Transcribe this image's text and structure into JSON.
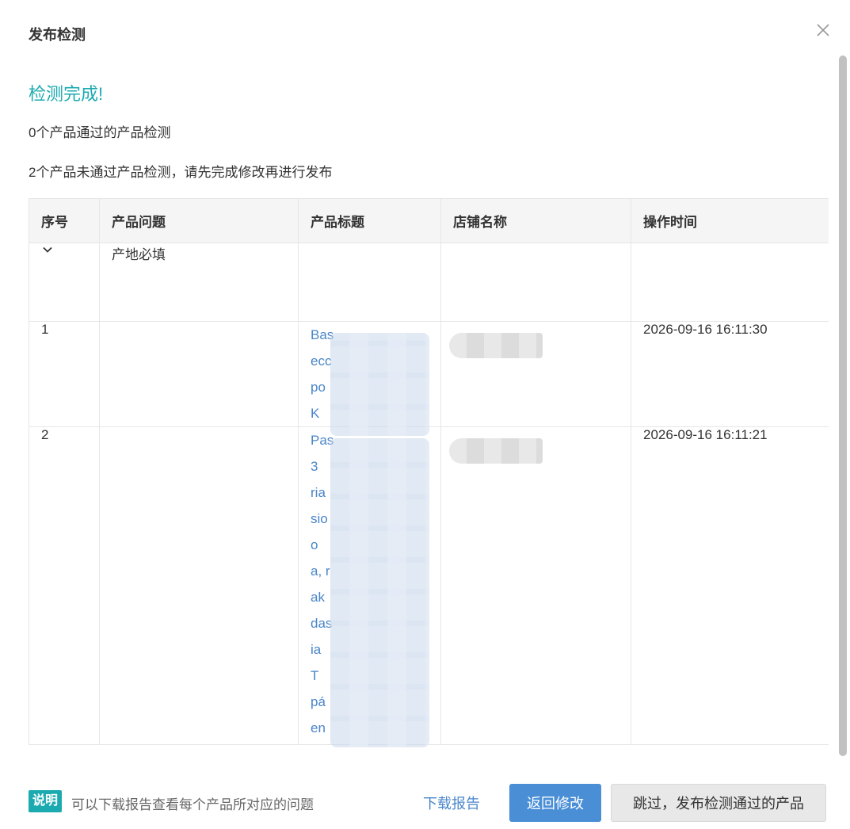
{
  "dialog": {
    "title": "发布检测",
    "close_icon": "close-icon"
  },
  "status": {
    "title": "检测完成!",
    "pass_summary": "0个产品通过的产品检测",
    "fail_summary": "2个产品未通过产品检测，请先完成修改再进行发布"
  },
  "table": {
    "headers": [
      "序号",
      "产品问题",
      "产品标题",
      "店铺名称",
      "操作时间"
    ],
    "group": {
      "issue": "产地必填",
      "toggle_icon": "chevron-down-icon"
    },
    "rows": [
      {
        "index": "1",
        "title_lines": [
          "Bas",
          "ecc",
          "po",
          "K"
        ],
        "time": "2026-09-16 16:11:30"
      },
      {
        "index": "2",
        "title_lines": [
          "Pas",
          "3",
          "ria",
          "sio",
          "o",
          "a, r",
          "ak",
          "das",
          "ia",
          "T",
          "pá",
          "en"
        ],
        "time": "2026-09-16 16:11:21"
      }
    ]
  },
  "footer": {
    "note_badge": "说明",
    "note_text": "可以下载报告查看每个产品所对应的问题",
    "download_label": "下载报告",
    "return_label": "返回修改",
    "skip_label": "跳过，发布检测通过的产品"
  },
  "colors": {
    "accent": "#1aaab0",
    "link": "#4a86c8",
    "primary_button": "#4a8ed6"
  }
}
